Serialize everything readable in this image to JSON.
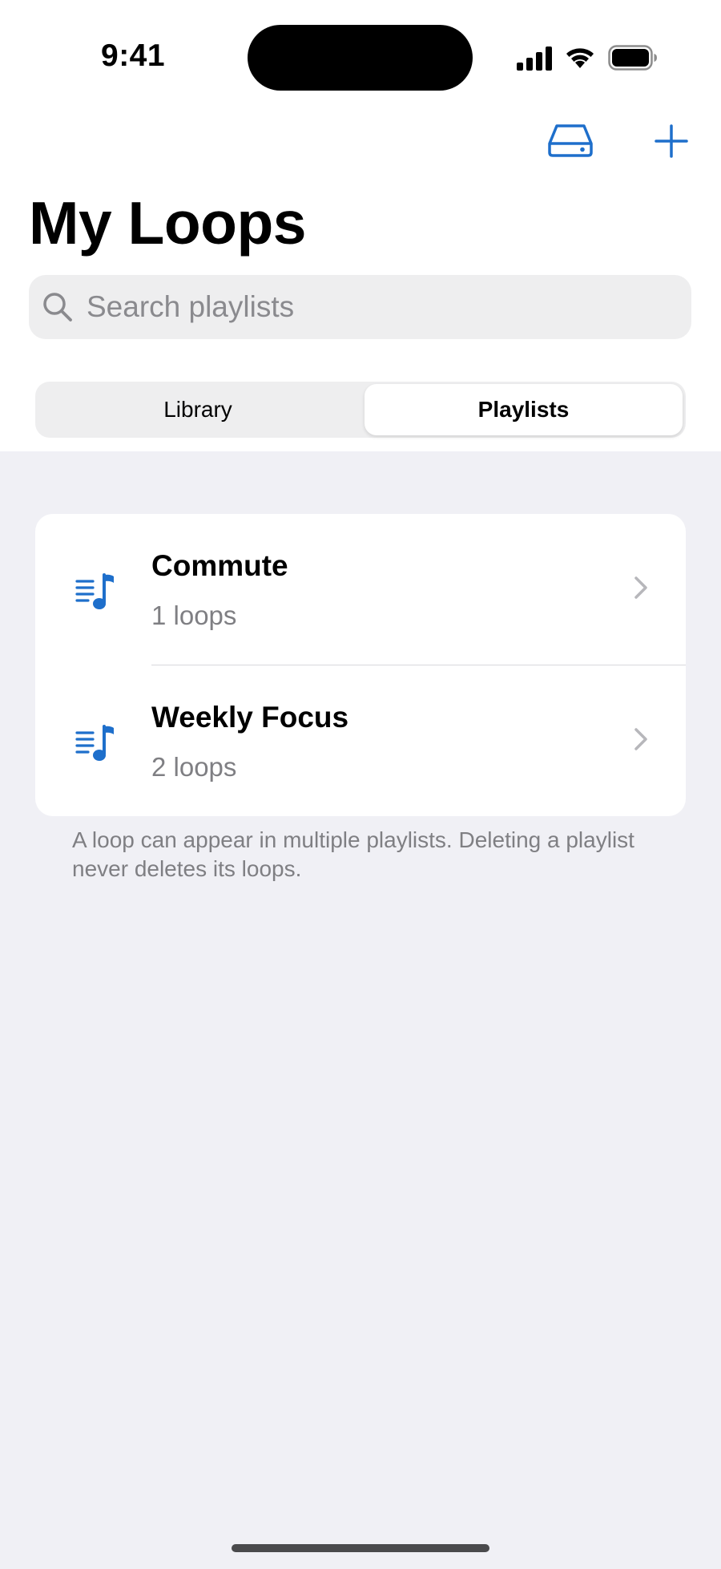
{
  "status_bar": {
    "time": "9:41"
  },
  "nav": {
    "drive_icon": "external-drive-icon",
    "add_icon": "plus-icon"
  },
  "page": {
    "title": "My Loops"
  },
  "search": {
    "placeholder": "Search playlists",
    "value": ""
  },
  "segmented_control": {
    "options": [
      {
        "label": "Library",
        "selected": false
      },
      {
        "label": "Playlists",
        "selected": true
      }
    ]
  },
  "playlists": [
    {
      "name": "Commute",
      "count": "1 loops",
      "icon": "music-list-icon"
    },
    {
      "name": "Weekly Focus",
      "count": "2 loops",
      "icon": "music-list-icon"
    }
  ],
  "footer": {
    "note": "A loop can appear in multiple playlists. Deleting a playlist never deletes its loops."
  },
  "colors": {
    "accent": "#1e6fcb",
    "background": "#f0f0f5",
    "secondary_text": "#7f7f83"
  }
}
